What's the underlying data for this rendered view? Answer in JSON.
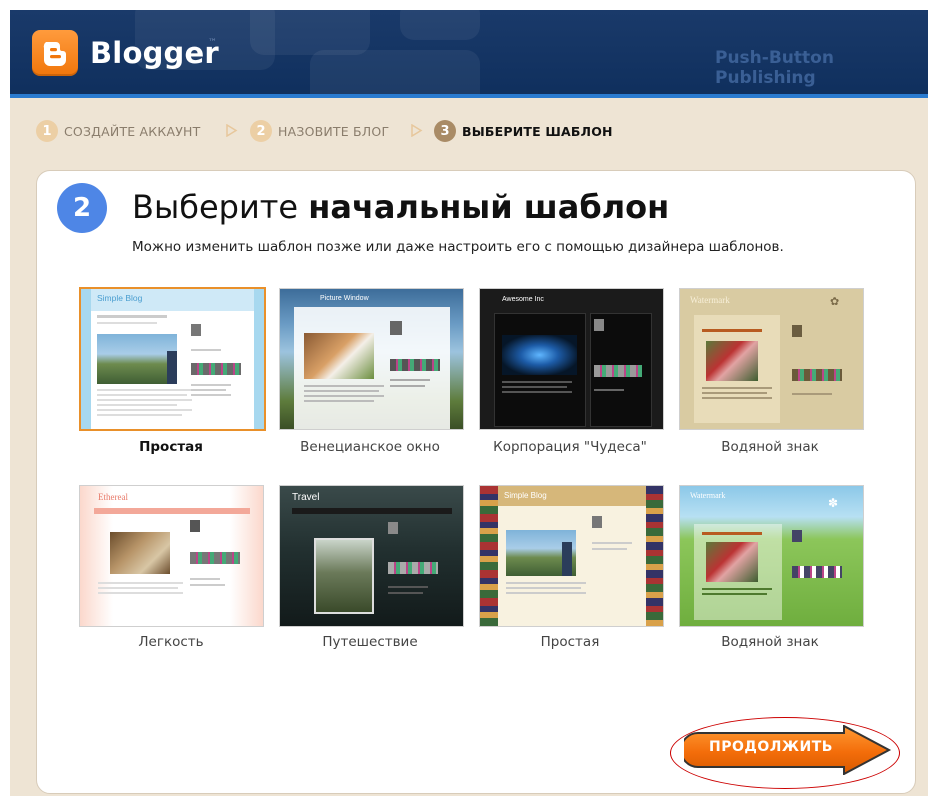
{
  "header": {
    "logo_text": "Blogger",
    "trademark": "™",
    "tagline": "Push-Button Publishing"
  },
  "steps": [
    {
      "number": "1",
      "label": "СОЗДАЙТЕ АККАУНТ",
      "active": false
    },
    {
      "number": "2",
      "label": "НАЗОВИТЕ БЛОГ",
      "active": false
    },
    {
      "number": "3",
      "label": "ВЫБЕРИТЕ ШАБЛОН",
      "active": true
    }
  ],
  "page": {
    "step_number": "2",
    "title_regular": "Выберите ",
    "title_bold": "начальный шаблон",
    "subtitle": "Можно изменить шаблон позже или даже настроить его с помощью дизайнера шаблонов."
  },
  "templates": [
    {
      "name": "Простая",
      "selected": true,
      "thumb_title": "Simple Blog"
    },
    {
      "name": "Венецианское окно",
      "selected": false,
      "thumb_title": "Picture Window"
    },
    {
      "name": "Корпорация \"Чудеса\"",
      "selected": false,
      "thumb_title": "Awesome Inc"
    },
    {
      "name": "Водяной знак",
      "selected": false,
      "thumb_title": "Watermark"
    },
    {
      "name": "Легкость",
      "selected": false,
      "thumb_title": "Ethereal"
    },
    {
      "name": "Путешествие",
      "selected": false,
      "thumb_title": "Travel"
    },
    {
      "name": "Простая",
      "selected": false,
      "thumb_title": "Simple Blog"
    },
    {
      "name": "Водяной знак",
      "selected": false,
      "thumb_title": "Watermark"
    }
  ],
  "continue_button": {
    "label": "ПРОДОЛЖИТЬ"
  },
  "colors": {
    "header_bg": "#0f2f5d",
    "logo_orange": "#f1760b",
    "step_bar_bg": "#eee4d4",
    "step_badge": "#eccfa5",
    "step_badge_active": "#a98b66",
    "big_badge_blue": "#4e86e6",
    "selected_border": "#e9902a",
    "button_orange": "#f36d0a",
    "highlight_oval": "#cc0000"
  },
  "icons": [
    "blogger-logo-icon",
    "step-arrow-icon",
    "continue-arrow-icon"
  ]
}
